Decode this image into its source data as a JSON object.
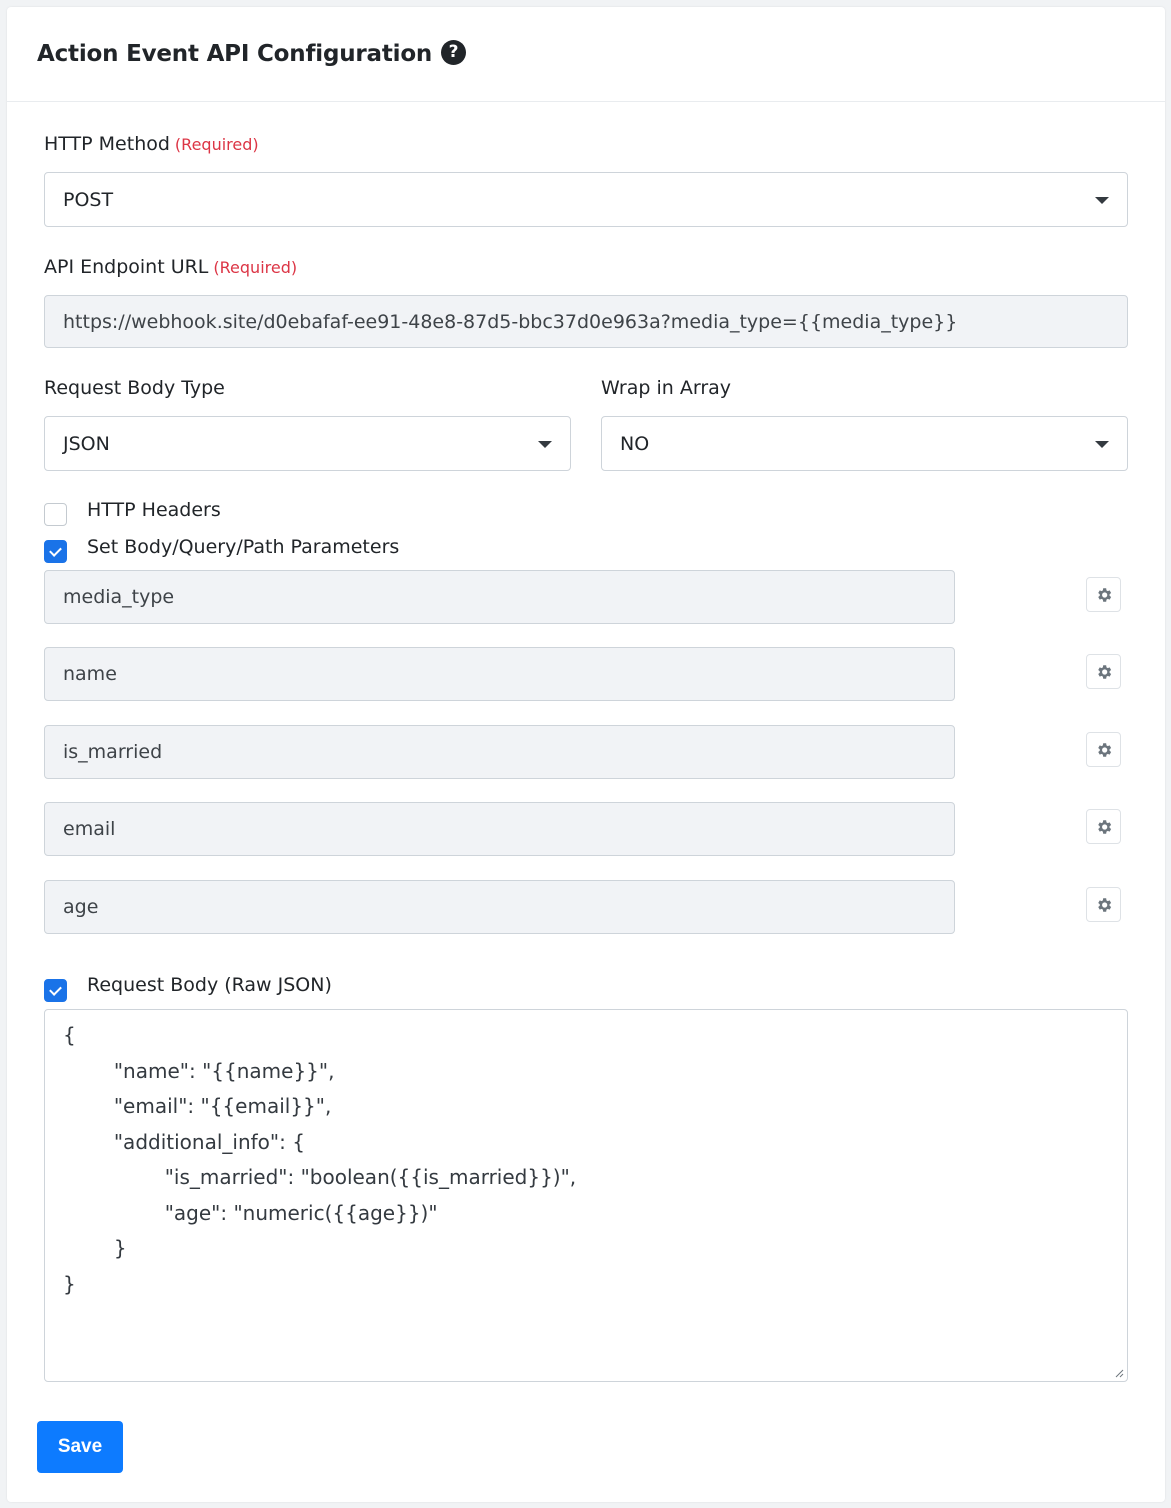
{
  "header": {
    "title": "Action Event API Configuration",
    "help_glyph": "?"
  },
  "http_method": {
    "label": "HTTP Method",
    "required": "(Required)",
    "value": "POST"
  },
  "endpoint": {
    "label": "API Endpoint URL",
    "required": "(Required)",
    "value": "https://webhook.site/d0ebafaf-ee91-48e8-87d5-bbc37d0e963a?media_type={{media_type}}"
  },
  "body_type": {
    "label": "Request Body Type",
    "value": "JSON"
  },
  "wrap_array": {
    "label": "Wrap in Array",
    "value": "NO"
  },
  "http_headers": {
    "label": "HTTP Headers",
    "checked": false
  },
  "params": {
    "label": "Set Body/Query/Path Parameters",
    "checked": true,
    "items": [
      {
        "name": "media_type"
      },
      {
        "name": "name"
      },
      {
        "name": "is_married"
      },
      {
        "name": "email"
      },
      {
        "name": "age"
      }
    ]
  },
  "raw_json": {
    "label": "Request Body (Raw JSON)",
    "checked": true,
    "lines": [
      "{",
      "        \"name\": \"{{name}}\",",
      "        \"email\": \"{{email}}\",",
      "        \"additional_info\": {",
      "                \"is_married\": \"boolean({{is_married}})\",",
      "                \"age\": \"numeric({{age}})\"",
      "        }",
      "}"
    ]
  },
  "save_label": "Save",
  "colors": {
    "primary": "#0d7bff",
    "required": "#dc3545",
    "checkbox": "#1a73e8"
  }
}
